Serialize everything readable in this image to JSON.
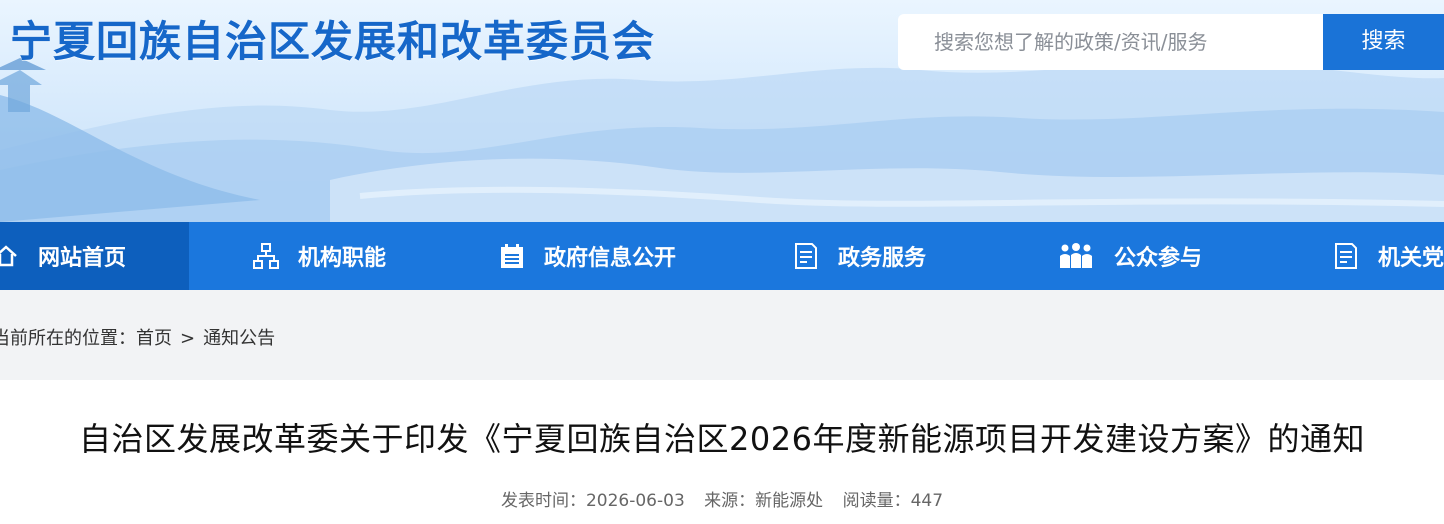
{
  "site": {
    "title": "宁夏回族自治区发展和改革委员会"
  },
  "search": {
    "placeholder": "搜索您想了解的政策/资讯/服务",
    "button_label": "搜索"
  },
  "nav": {
    "items": [
      {
        "label": "网站首页",
        "icon": "home-icon",
        "active": true
      },
      {
        "label": "机构职能",
        "icon": "org-chart-icon"
      },
      {
        "label": "政府信息公开",
        "icon": "calendar-list-icon"
      },
      {
        "label": "政务服务",
        "icon": "document-icon"
      },
      {
        "label": "公众参与",
        "icon": "people-icon"
      },
      {
        "label": "机关党建",
        "icon": "document-icon"
      }
    ]
  },
  "breadcrumb": {
    "prefix": "当前所在的位置：",
    "home": "首页",
    "separator": ">",
    "current": "通知公告"
  },
  "article": {
    "title": "自治区发展改革委关于印发《宁夏回族自治区2026年度新能源项目开发建设方案》的通知",
    "meta": {
      "date_label": "发表时间：",
      "date": "2026-06-03",
      "source_label": "来源：",
      "source": "新能源处",
      "reads_label": "阅读量：",
      "reads": "447"
    }
  },
  "colors": {
    "brand_blue": "#1b77dd",
    "active_nav": "#0d5fbd",
    "title_blue": "#1667c9"
  }
}
